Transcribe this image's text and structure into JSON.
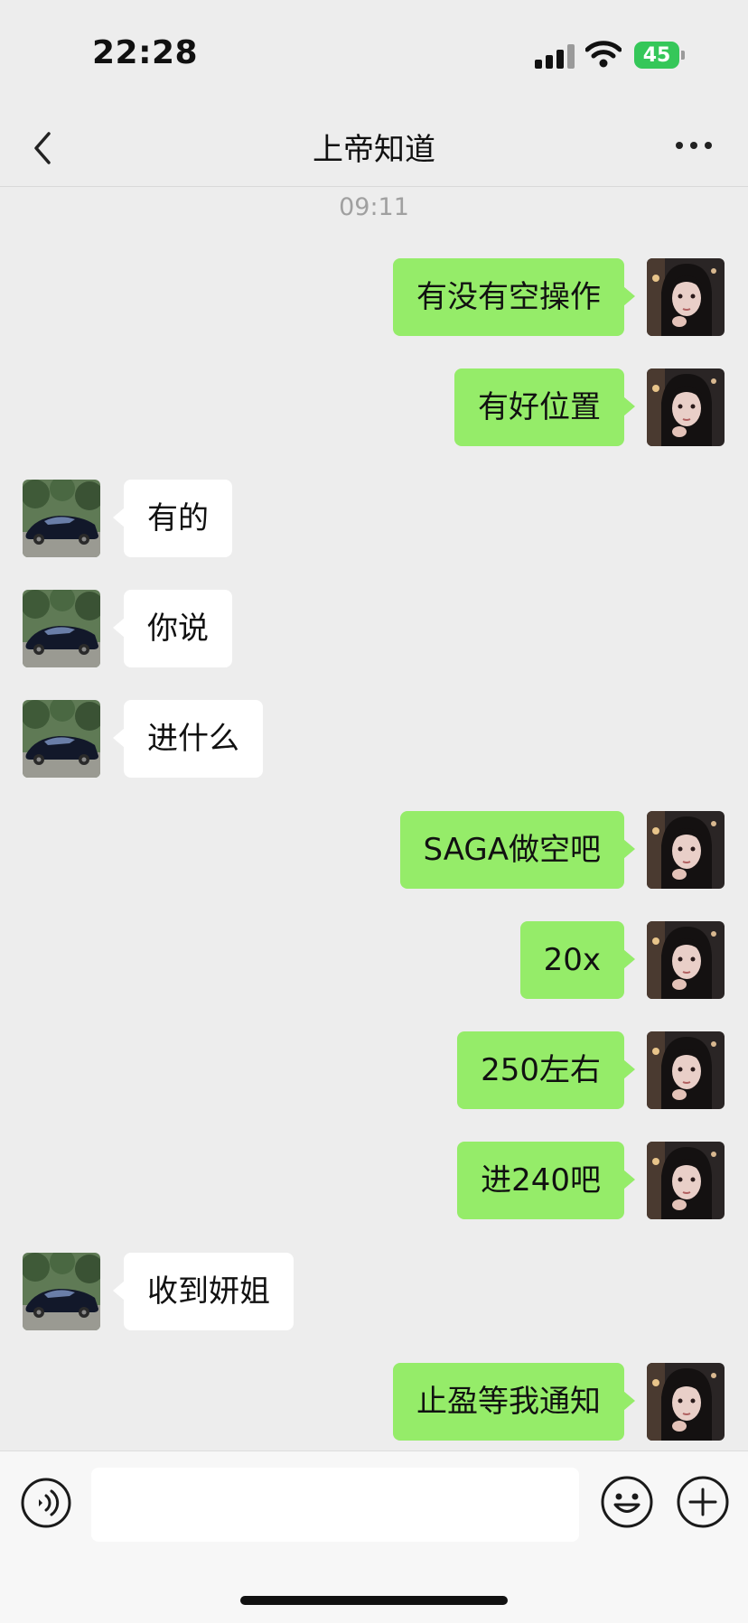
{
  "status_bar": {
    "time": "22:28",
    "battery": "45"
  },
  "nav": {
    "title": "上帝知道"
  },
  "chat": {
    "timestamp": "09:11",
    "messages": [
      {
        "from": "me",
        "text": "有没有空操作"
      },
      {
        "from": "me",
        "text": "有好位置"
      },
      {
        "from": "them",
        "text": "有的"
      },
      {
        "from": "them",
        "text": "你说"
      },
      {
        "from": "them",
        "text": "进什么"
      },
      {
        "from": "me",
        "text": "SAGA做空吧"
      },
      {
        "from": "me",
        "text": "20x"
      },
      {
        "from": "me",
        "text": "250左右"
      },
      {
        "from": "me",
        "text": "进240吧"
      },
      {
        "from": "them",
        "text": "收到妍姐"
      },
      {
        "from": "me",
        "text": "止盈等我通知"
      }
    ]
  },
  "input": {
    "value": ""
  },
  "colors": {
    "my_bubble": "#95ec69",
    "their_bubble": "#ffffff",
    "background": "#ededed"
  },
  "icons": [
    "back-icon",
    "more-icon",
    "voice-icon",
    "emoji-icon",
    "plus-icon"
  ]
}
